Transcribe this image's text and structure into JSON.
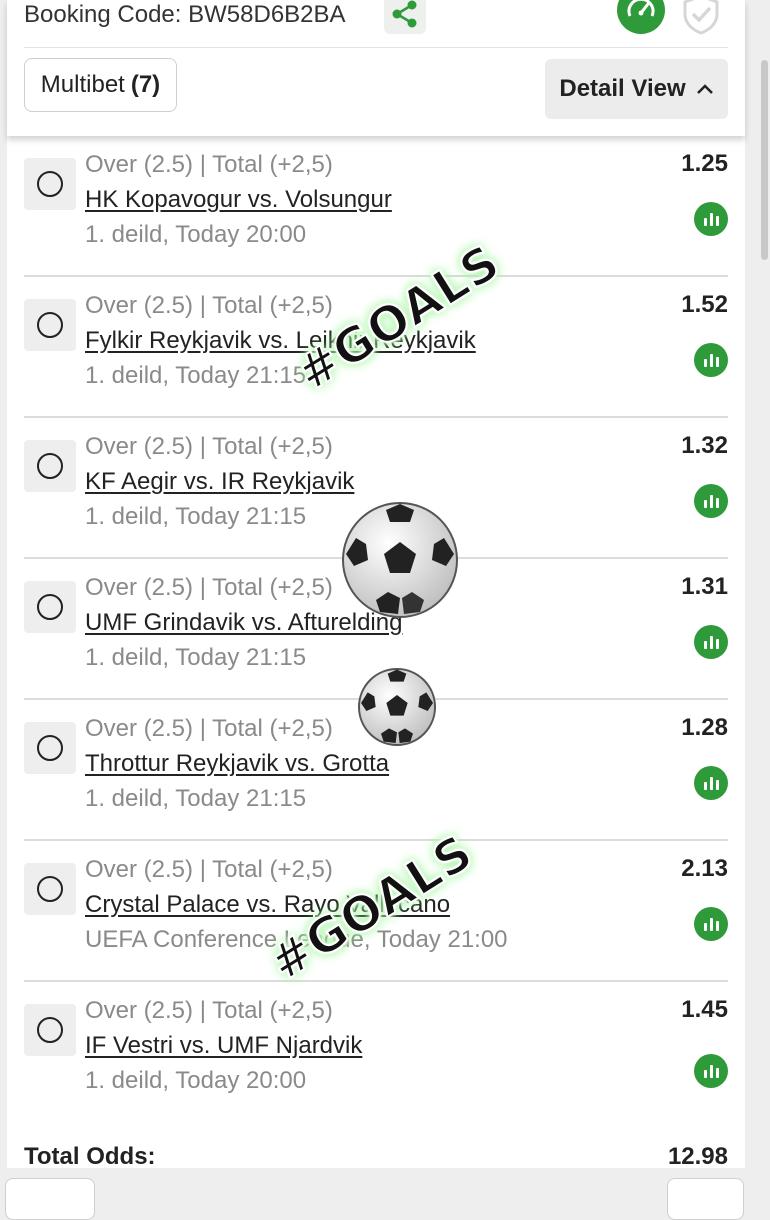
{
  "header": {
    "booking_label": "Booking Code:",
    "booking_code": "BW58D6B2BA",
    "multibet_label": "Multibet",
    "multibet_count": "(7)",
    "detail_label": "Detail View"
  },
  "bets": [
    {
      "market": "Over (2.5) | Total (+2,5)",
      "match": "HK Kopavogur vs. Volsungur",
      "league": "1. deild, Today 20:00",
      "odds": "1.25"
    },
    {
      "market": "Over (2.5) | Total (+2,5)",
      "match": "Fylkir Reykjavik vs. Leiknir Reykjavik",
      "league": "1. deild, Today 21:15",
      "odds": "1.52"
    },
    {
      "market": "Over (2.5) | Total (+2,5)",
      "match": "KF Aegir vs. IR Reykjavik",
      "league": "1. deild, Today 21:15",
      "odds": "1.32"
    },
    {
      "market": "Over (2.5) | Total (+2,5)",
      "match": "UMF Grindavik vs. Afturelding",
      "league": "1. deild, Today 21:15",
      "odds": "1.31"
    },
    {
      "market": "Over (2.5) | Total (+2,5)",
      "match": "Throttur Reykjavik vs. Grotta",
      "league": "1. deild, Today 21:15",
      "odds": "1.28"
    },
    {
      "market": "Over (2.5) | Total (+2,5)",
      "match": "Crystal Palace vs. Rayo Vallecano",
      "league": "UEFA Conference League, Today 21:00",
      "odds": "2.13"
    },
    {
      "market": "Over (2.5) | Total (+2,5)",
      "match": "IF Vestri vs. UMF Njardvik",
      "league": "1. deild, Today 20:00",
      "odds": "1.45"
    }
  ],
  "footer": {
    "total_label": "Total Odds:",
    "total_value": "12.98"
  },
  "stickers": {
    "text_1": "#GOALS",
    "text_2": "#GOALS"
  },
  "colors": {
    "accent_green": "#2e9a3a",
    "muted_text": "#8a8a8a"
  },
  "icons": [
    "share-icon",
    "speedometer-icon",
    "check-shield-icon",
    "chevron-up-icon",
    "radio-icon",
    "stats-icon",
    "soccer-ball-icon"
  ]
}
